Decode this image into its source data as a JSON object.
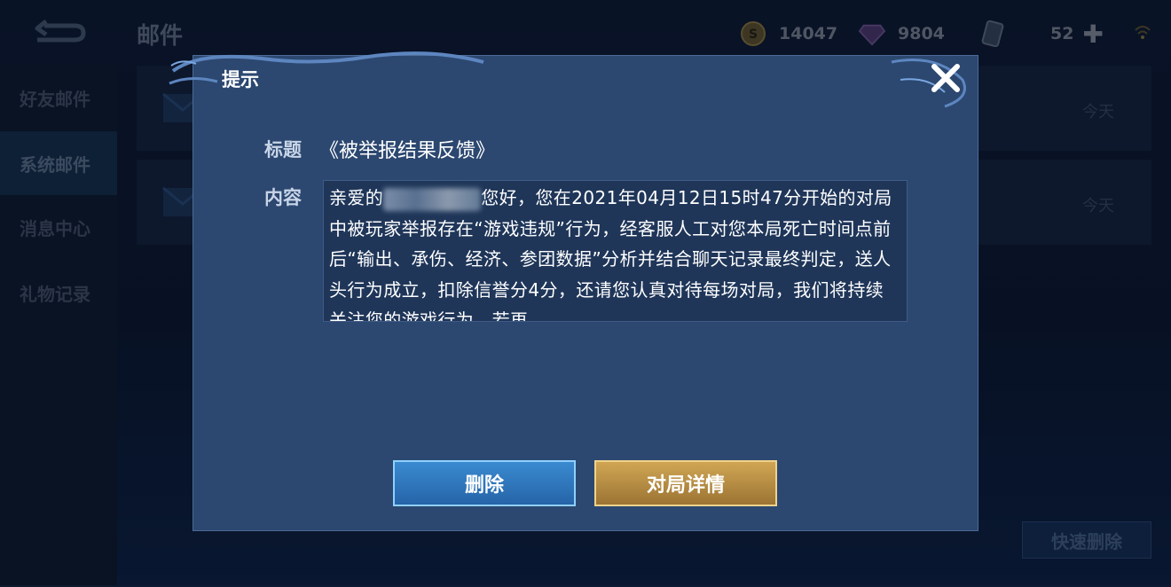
{
  "header": {
    "page_title": "邮件",
    "resources": [
      {
        "name": "gold",
        "value": "14047"
      },
      {
        "name": "gem",
        "value": "9804"
      },
      {
        "name": "card",
        "value": "52"
      }
    ]
  },
  "sidebar": {
    "items": [
      {
        "label": "好友邮件"
      },
      {
        "label": "系统邮件"
      },
      {
        "label": "消息中心"
      },
      {
        "label": "礼物记录"
      }
    ]
  },
  "mails": [
    {
      "date": "今天"
    },
    {
      "date": "今天"
    }
  ],
  "quick_delete": "快速删除",
  "dialog": {
    "title": "提示",
    "subject_label": "标题",
    "subject": "《被举报结果反馈》",
    "content_label": "内容",
    "content_prefix": "亲爱的",
    "content_after_name": "您好，您在2021年04月12日15时47分开始的对局中被玩家举报存在“游戏违规”行为，经客服人工对您本局死亡时间点前后“输出、承伤、经济、参团数据”分析并结合聊天记录最终判定，送人头行为成立，扣除信誉分4分，还请您认真对待每场对局，我们将持续关注您的游戏行为，若再",
    "delete_button": "删除",
    "detail_button": "对局详情"
  },
  "colors": {
    "dialog_bg": "#2c4870",
    "delete_button": "#2f78c0",
    "detail_button": "#c29a4a"
  }
}
